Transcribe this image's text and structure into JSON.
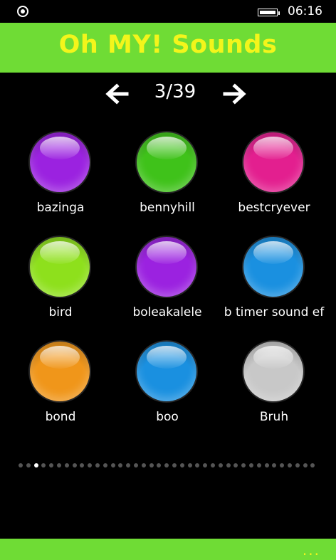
{
  "status": {
    "time": "06:16"
  },
  "header": {
    "title": "Oh MY! Sounds"
  },
  "pager": {
    "counter": "3/39",
    "total_pages": 39,
    "current_page": 3
  },
  "sounds": [
    {
      "label": "bazinga",
      "color": "#9b22e0"
    },
    {
      "label": "bennyhill",
      "color": "#3fc21a"
    },
    {
      "label": "bestcryever",
      "color": "#e31f8f"
    },
    {
      "label": "bird",
      "color": "#8ee01c"
    },
    {
      "label": "boleakalele",
      "color": "#9b22e0"
    },
    {
      "label": "b timer sound ef",
      "color": "#1a90e0"
    },
    {
      "label": "bond",
      "color": "#f0961a"
    },
    {
      "label": "boo",
      "color": "#1a90e0"
    },
    {
      "label": "Bruh",
      "color": "#c8c8c8"
    }
  ],
  "appbar": {
    "more_label": "..."
  },
  "colors": {
    "accent_green": "#6fdc35",
    "title_yellow": "#f3f51b"
  }
}
